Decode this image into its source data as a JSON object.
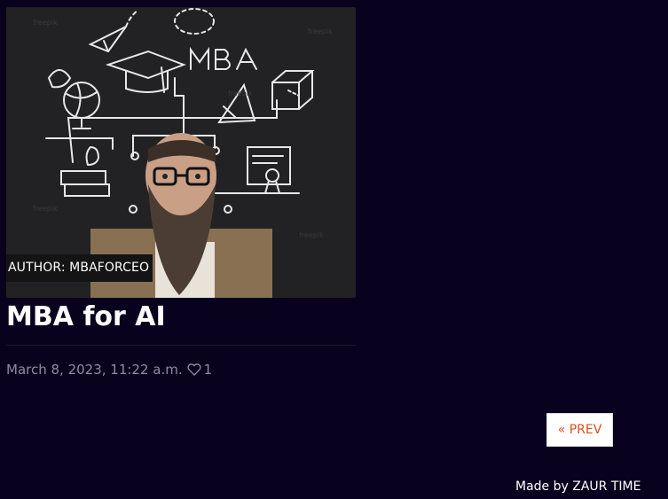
{
  "post": {
    "author_label": "AUTHOR: MBAFORCEO",
    "title": "MBA for AI",
    "date": "March 8, 2023, 11:22 a.m.",
    "likes": "1",
    "image_text": "MBA"
  },
  "pagination": {
    "prev_label": "« PREV"
  },
  "footer": {
    "credit": "Made by ZAUR TIME"
  },
  "colors": {
    "background": "#09021f",
    "accent": "#d64e1f"
  }
}
